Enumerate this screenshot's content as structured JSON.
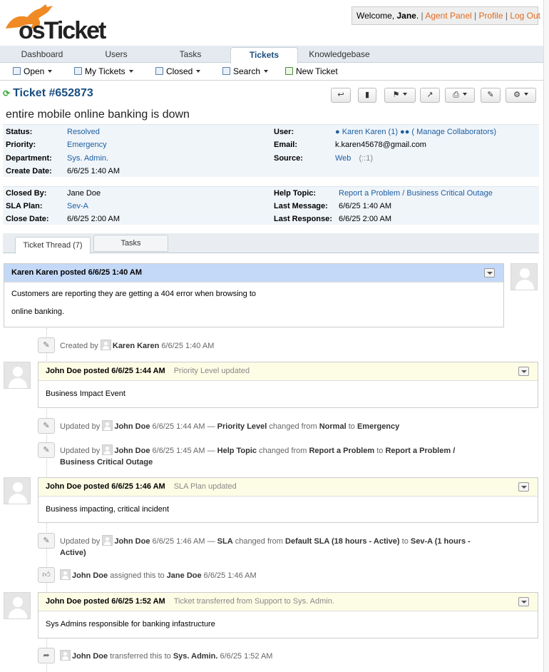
{
  "brand": {
    "logo_text": "osTicket"
  },
  "welcome": {
    "prefix": "Welcome, ",
    "user": "Jane",
    "suffix": ".",
    "agent_panel": "Agent Panel",
    "profile": "Profile",
    "logout": "Log Out"
  },
  "nav": {
    "tabs": [
      "Dashboard",
      "Users",
      "Tasks",
      "Tickets",
      "Knowledgebase"
    ],
    "active": "Tickets"
  },
  "subnav": {
    "open": "Open",
    "my_tickets": "My Tickets",
    "closed": "Closed",
    "search": "Search",
    "new_ticket": "New Ticket"
  },
  "ticket": {
    "number": "Ticket #652873",
    "subject": "entire mobile online banking is down",
    "info1": {
      "status_label": "Status:",
      "status": "Resolved",
      "priority_label": "Priority:",
      "priority": "Emergency",
      "department_label": "Department:",
      "department": "Sys. Admin.",
      "create_label": "Create Date:",
      "create_date": "6/6/25 1:40 AM",
      "user_label": "User:",
      "user": "Karen Karen (1)",
      "manage": "( Manage Collaborators)",
      "email_label": "Email:",
      "email": "k.karen45678@gmail.com",
      "source_label": "Source:",
      "source": "Web",
      "source_ip": "(::1)"
    },
    "info2": {
      "closed_by_label": "Closed By:",
      "closed_by": "Jane Doe",
      "sla_label": "SLA Plan:",
      "sla": "Sev-A",
      "close_date_label": "Close Date:",
      "close_date": "6/6/25 2:00 AM",
      "help_topic_label": "Help Topic:",
      "help_topic": "Report a Problem / Business Critical Outage",
      "last_message_label": "Last Message:",
      "last_message": "6/6/25 1:40 AM",
      "last_response_label": "Last Response:",
      "last_response": "6/6/25 2:00 AM"
    }
  },
  "tabs": {
    "thread": "Ticket Thread (7)",
    "tasks": "Tasks"
  },
  "thread": {
    "msg1": {
      "header": "Karen Karen posted 6/6/25 1:40 AM",
      "line1": "Customers are reporting they are getting a 404 error when browsing to",
      "line2": "online banking."
    },
    "ev_created": {
      "pre": "Created by",
      "who": "Karen Karen",
      "when": "6/6/25 1:40 AM"
    },
    "resp1": {
      "header": "John Doe posted 6/6/25 1:44 AM",
      "note": "Priority Level updated",
      "body": "Business Impact Event"
    },
    "ev_upd1": {
      "pre": "Updated by",
      "who": "John Doe",
      "when": "6/6/25 1:44 AM —",
      "field": "Priority Level",
      "mid": "changed from",
      "from": "Normal",
      "to_word": "to",
      "to": "Emergency"
    },
    "ev_upd2": {
      "pre": "Updated by",
      "who": "John Doe",
      "when": "6/6/25 1:45 AM —",
      "field": "Help Topic",
      "mid": "changed from",
      "from": "Report a Problem",
      "to_word": "to",
      "to": "Report a Problem /",
      "to2": "Business Critical Outage"
    },
    "resp2": {
      "header": "John Doe posted 6/6/25 1:46 AM",
      "note": "SLA Plan updated",
      "body": "Business impacting, critical incident"
    },
    "ev_upd3": {
      "pre": "Updated by",
      "who": "John Doe",
      "when": "6/6/25 1:46 AM —",
      "field": "SLA",
      "mid": "changed from",
      "from": "Default SLA (18 hours - Active)",
      "to_word": "to",
      "to": "Sev-A (1 hours -",
      "to2": "Active)"
    },
    "ev_assign": {
      "who": "John Doe",
      "mid": "assigned this to",
      "target": "Jane Doe",
      "when": "6/6/25 1:46 AM"
    },
    "resp3": {
      "header": "John Doe posted 6/6/25 1:52 AM",
      "note": "Ticket transferred from Support to Sys. Admin.",
      "body": "Sys Admins responsible for banking infastructure"
    },
    "ev_transfer": {
      "who": "John Doe",
      "mid": "transferred this to",
      "target": "Sys. Admin.",
      "when": "6/6/25 1:52 AM"
    }
  }
}
